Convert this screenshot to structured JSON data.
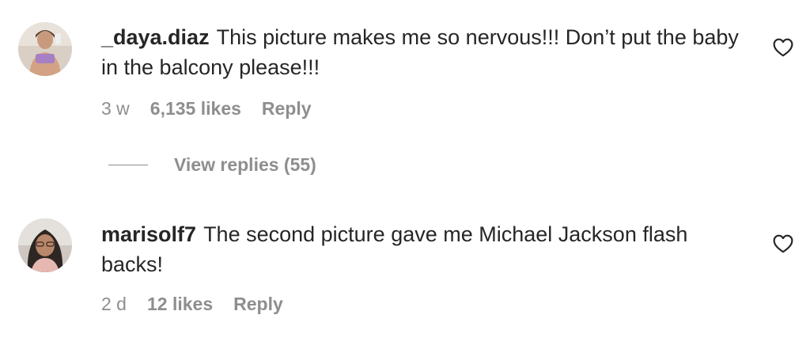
{
  "comments": [
    {
      "username": "_daya.diaz",
      "text": "This picture makes me so nervous!!! Don’t put the baby in the balcony please!!!",
      "time": "3 w",
      "likes": "6,135 likes",
      "reply_label": "Reply",
      "avatar_icon": "user-avatar-photo",
      "like_icon": "heart-outline-icon"
    },
    {
      "username": "marisolf7",
      "text": "The second picture gave me Michael Jackson flash backs!",
      "time": "2 d",
      "likes": "12 likes",
      "reply_label": "Reply",
      "avatar_icon": "user-avatar-photo",
      "like_icon": "heart-outline-icon"
    }
  ],
  "view_replies": {
    "label": "View replies (55)"
  },
  "colors": {
    "text": "#262626",
    "secondary": "#8e8e8e",
    "background": "#ffffff"
  }
}
